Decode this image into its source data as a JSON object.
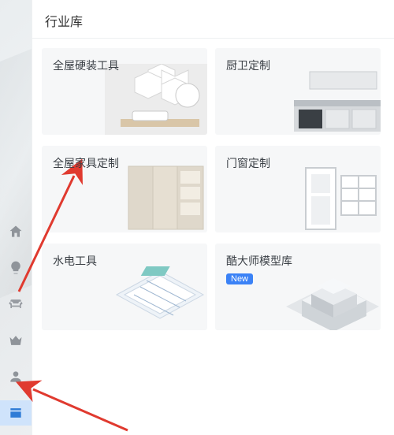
{
  "panel": {
    "title": "行业库"
  },
  "cards": [
    {
      "label": "全屋硬装工具",
      "badge": null
    },
    {
      "label": "厨卫定制",
      "badge": null
    },
    {
      "label": "全屋家具定制",
      "badge": null
    },
    {
      "label": "门窗定制",
      "badge": null
    },
    {
      "label": "水电工具",
      "badge": null
    },
    {
      "label": "酷大师模型库",
      "badge": "New"
    }
  ],
  "rail": [
    {
      "name": "home-icon",
      "active": false
    },
    {
      "name": "bulb-icon",
      "active": false
    },
    {
      "name": "sofa-icon",
      "active": false
    },
    {
      "name": "crown-icon",
      "active": false
    },
    {
      "name": "user-icon",
      "active": false
    },
    {
      "name": "library-icon",
      "active": true
    }
  ],
  "colors": {
    "accent": "#3b82f6",
    "arrow": "#e03a2f"
  }
}
